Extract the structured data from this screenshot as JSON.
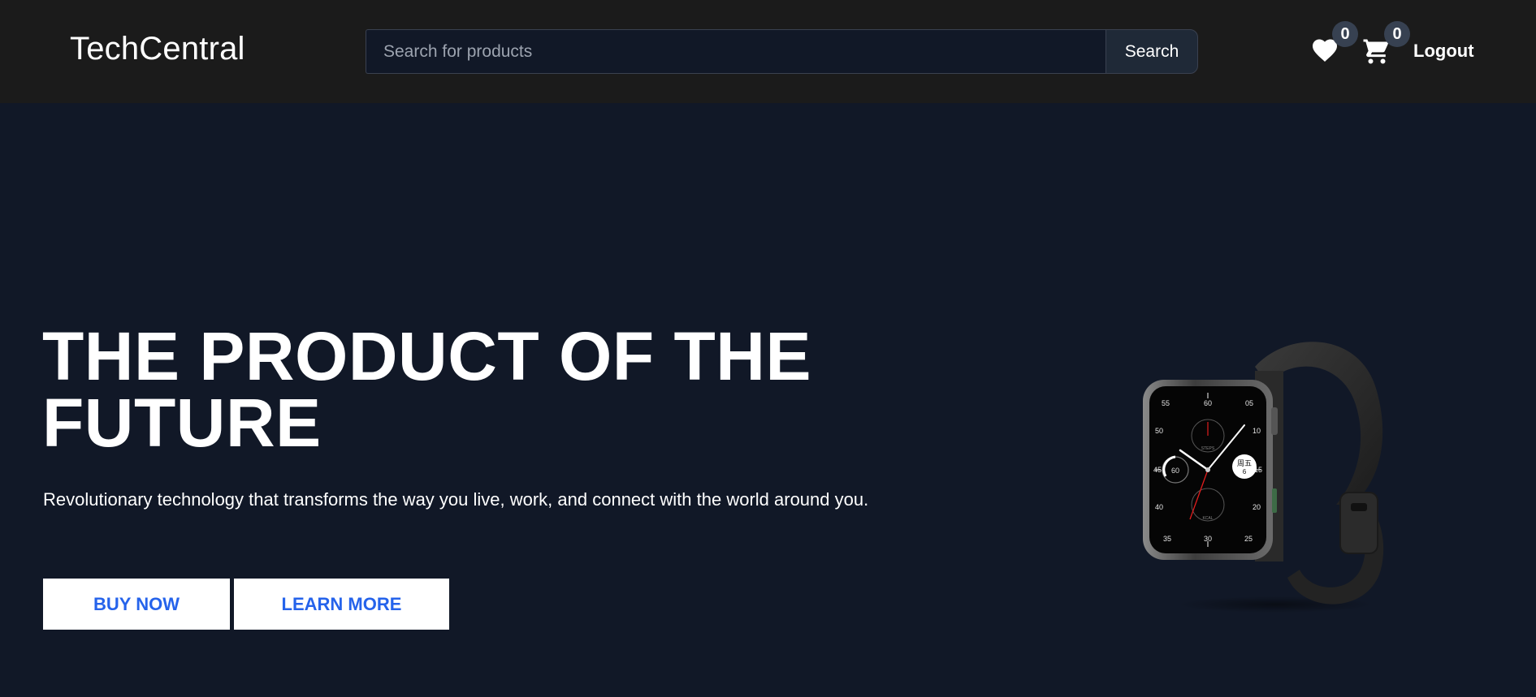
{
  "header": {
    "brand": "TechCentral",
    "search": {
      "placeholder": "Search for products",
      "button_label": "Search"
    },
    "wishlist": {
      "icon": "heart-icon",
      "count": "0"
    },
    "cart": {
      "icon": "cart-icon",
      "count": "0"
    },
    "logout_label": "Logout"
  },
  "hero": {
    "title": "THE PRODUCT OF THE FUTURE",
    "subtitle": "Revolutionary technology that transforms the way you live, work, and connect with the world around you.",
    "primary_button": "BUY NOW",
    "secondary_button": "LEARN MORE",
    "image": "smartwatch",
    "watch_face": {
      "chinese_label": "周五",
      "date": "6",
      "left_dial": "60",
      "top_dial": "STEPS",
      "bottom_dial": "KCAL",
      "minute_marks": [
        "55",
        "60",
        "05",
        "50",
        "10",
        "45",
        "15",
        "40",
        "20",
        "35",
        "30",
        "25"
      ]
    }
  },
  "colors": {
    "nav_bg": "#1b1b1b",
    "page_bg": "#111827",
    "button_text": "#2563eb",
    "badge_bg": "#374151"
  }
}
